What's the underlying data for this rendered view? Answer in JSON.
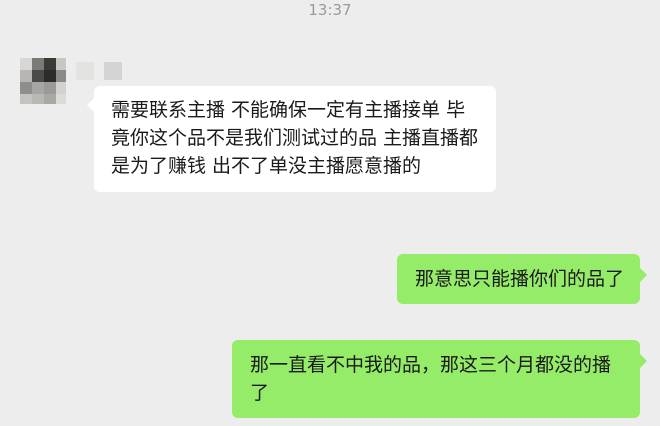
{
  "chat": {
    "timestamp": "13:37",
    "contact": {
      "avatar_icon": "blurred-avatar-icon",
      "name_icon": "blurred-name-icon"
    },
    "messages": [
      {
        "direction": "incoming",
        "text": "需要联系主播  不能确保一定有主播接单  毕竟你这个品不是我们测试过的品  主播直播都是为了赚钱  出不了单没主播愿意播的"
      },
      {
        "direction": "outgoing",
        "text": "那意思只能播你们的品了"
      },
      {
        "direction": "outgoing",
        "text": "那一直看不中我的品，那这三个月都没的播了"
      }
    ]
  },
  "colors": {
    "background": "#ededed",
    "incoming_bubble": "#ffffff",
    "outgoing_bubble": "#95ec69",
    "timestamp_text": "#9a9a9a"
  }
}
